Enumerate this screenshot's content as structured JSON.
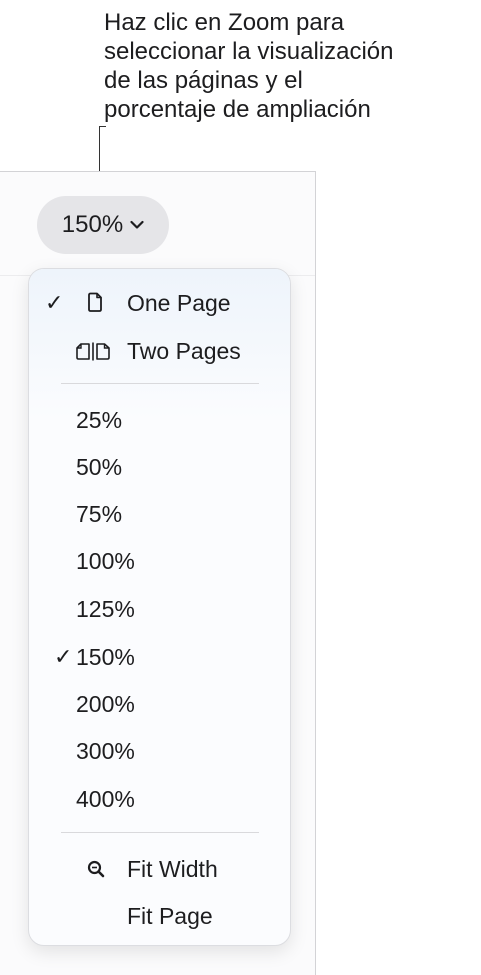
{
  "callout": {
    "lines": [
      "Haz clic en Zoom para",
      "seleccionar la visualización",
      "de las páginas y el",
      "porcentaje de ampliación"
    ]
  },
  "toolbar": {
    "zoom_label": "150%",
    "zoom_icon": "chevron-down-icon"
  },
  "menu": {
    "view_items": [
      {
        "label": "One Page",
        "checked": true,
        "icon": "single-page-icon"
      },
      {
        "label": "Two Pages",
        "checked": false,
        "icon": "two-pages-icon"
      }
    ],
    "zoom_levels": [
      {
        "label": "25%",
        "checked": false
      },
      {
        "label": "50%",
        "checked": false
      },
      {
        "label": "75%",
        "checked": false
      },
      {
        "label": "100%",
        "checked": false
      },
      {
        "label": "125%",
        "checked": false
      },
      {
        "label": "150%",
        "checked": true
      },
      {
        "label": "200%",
        "checked": false
      },
      {
        "label": "300%",
        "checked": false
      },
      {
        "label": "400%",
        "checked": false
      }
    ],
    "fit_items": [
      {
        "label": "Fit Width",
        "icon": "magnifier-icon"
      },
      {
        "label": "Fit Page",
        "icon": ""
      }
    ],
    "checkmark": "✓"
  },
  "colors": {
    "text": "#1d1d1f",
    "zoom_button_bg": "#e5e5e8",
    "menu_bg": "#fbfcfe",
    "menu_tint": "#eef4fb"
  }
}
